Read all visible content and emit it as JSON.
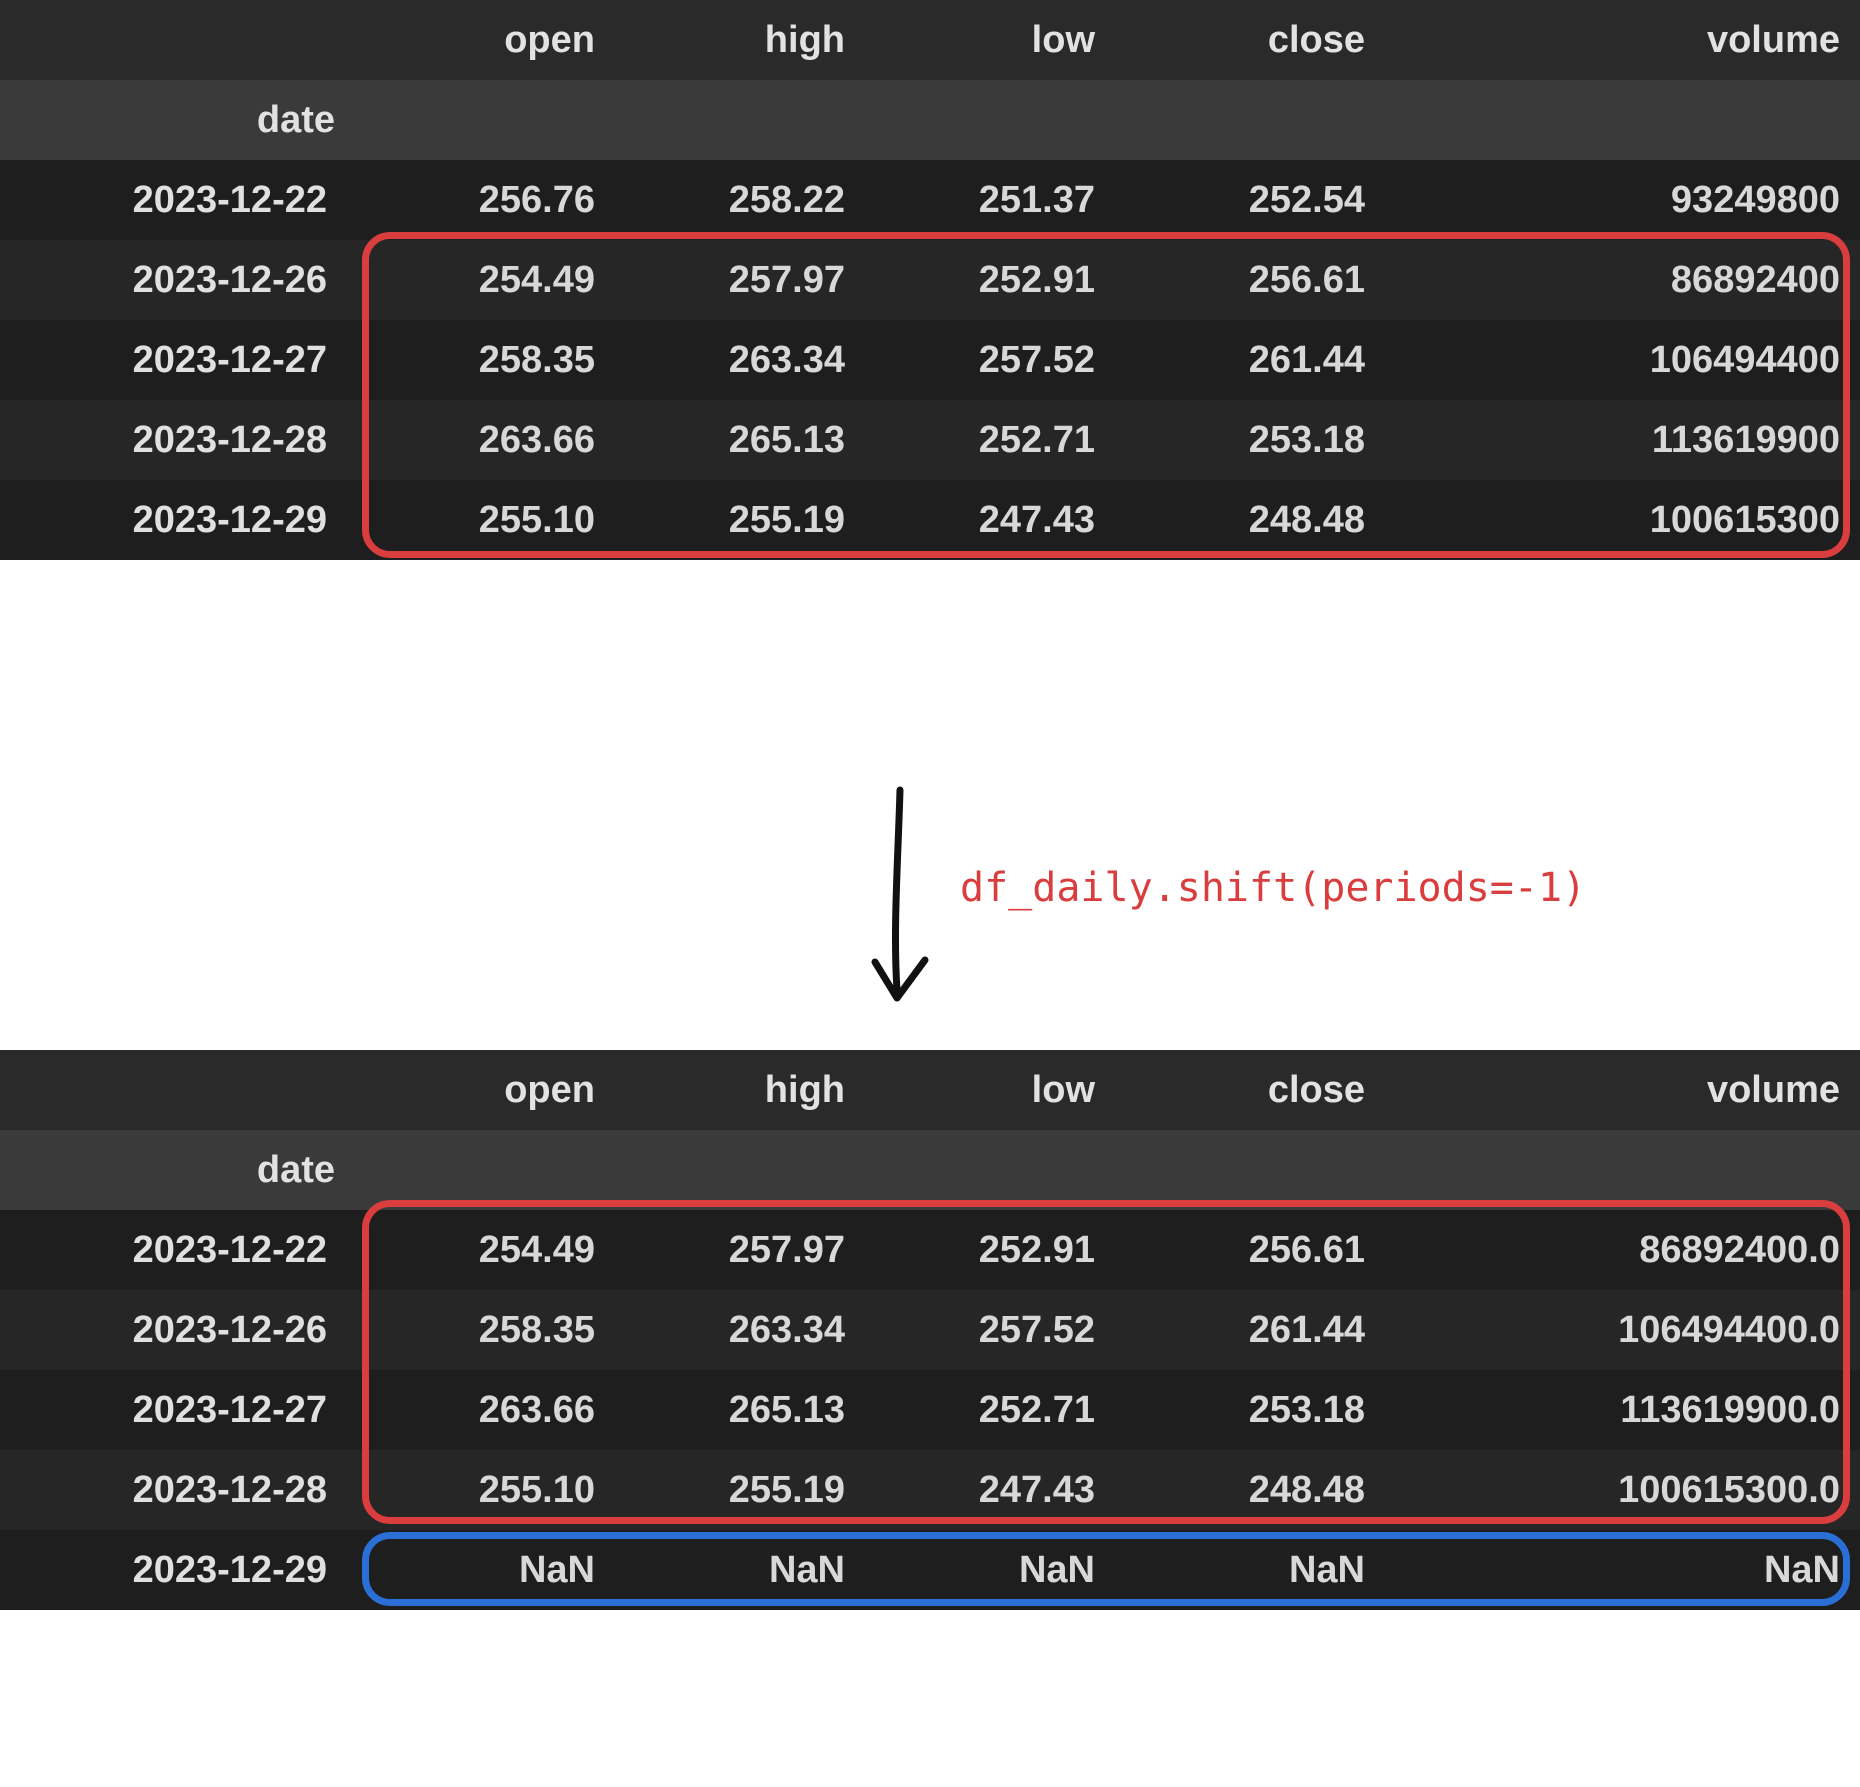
{
  "columns": [
    "open",
    "high",
    "low",
    "close",
    "volume"
  ],
  "index_label": "date",
  "annotation_code": "df_daily.shift(periods=-1)",
  "table_top": {
    "rows": [
      {
        "date": "2023-12-22",
        "open": "256.76",
        "high": "258.22",
        "low": "251.37",
        "close": "252.54",
        "volume": "93249800"
      },
      {
        "date": "2023-12-26",
        "open": "254.49",
        "high": "257.97",
        "low": "252.91",
        "close": "256.61",
        "volume": "86892400"
      },
      {
        "date": "2023-12-27",
        "open": "258.35",
        "high": "263.34",
        "low": "257.52",
        "close": "261.44",
        "volume": "106494400"
      },
      {
        "date": "2023-12-28",
        "open": "263.66",
        "high": "265.13",
        "low": "252.71",
        "close": "253.18",
        "volume": "113619900"
      },
      {
        "date": "2023-12-29",
        "open": "255.10",
        "high": "255.19",
        "low": "247.43",
        "close": "248.48",
        "volume": "100615300"
      }
    ],
    "highlight": {
      "type": "red",
      "rows_start": 1,
      "rows_end": 4
    }
  },
  "table_bottom": {
    "rows": [
      {
        "date": "2023-12-22",
        "open": "254.49",
        "high": "257.97",
        "low": "252.91",
        "close": "256.61",
        "volume": "86892400.0"
      },
      {
        "date": "2023-12-26",
        "open": "258.35",
        "high": "263.34",
        "low": "257.52",
        "close": "261.44",
        "volume": "106494400.0"
      },
      {
        "date": "2023-12-27",
        "open": "263.66",
        "high": "265.13",
        "low": "252.71",
        "close": "253.18",
        "volume": "113619900.0"
      },
      {
        "date": "2023-12-28",
        "open": "255.10",
        "high": "255.19",
        "low": "247.43",
        "close": "248.48",
        "volume": "100615300.0"
      },
      {
        "date": "2023-12-29",
        "open": "NaN",
        "high": "NaN",
        "low": "NaN",
        "close": "NaN",
        "volume": "NaN"
      }
    ],
    "highlight_main": {
      "type": "red",
      "rows_start": 0,
      "rows_end": 3
    },
    "highlight_nan": {
      "type": "blue",
      "rows_start": 4,
      "rows_end": 4
    }
  }
}
